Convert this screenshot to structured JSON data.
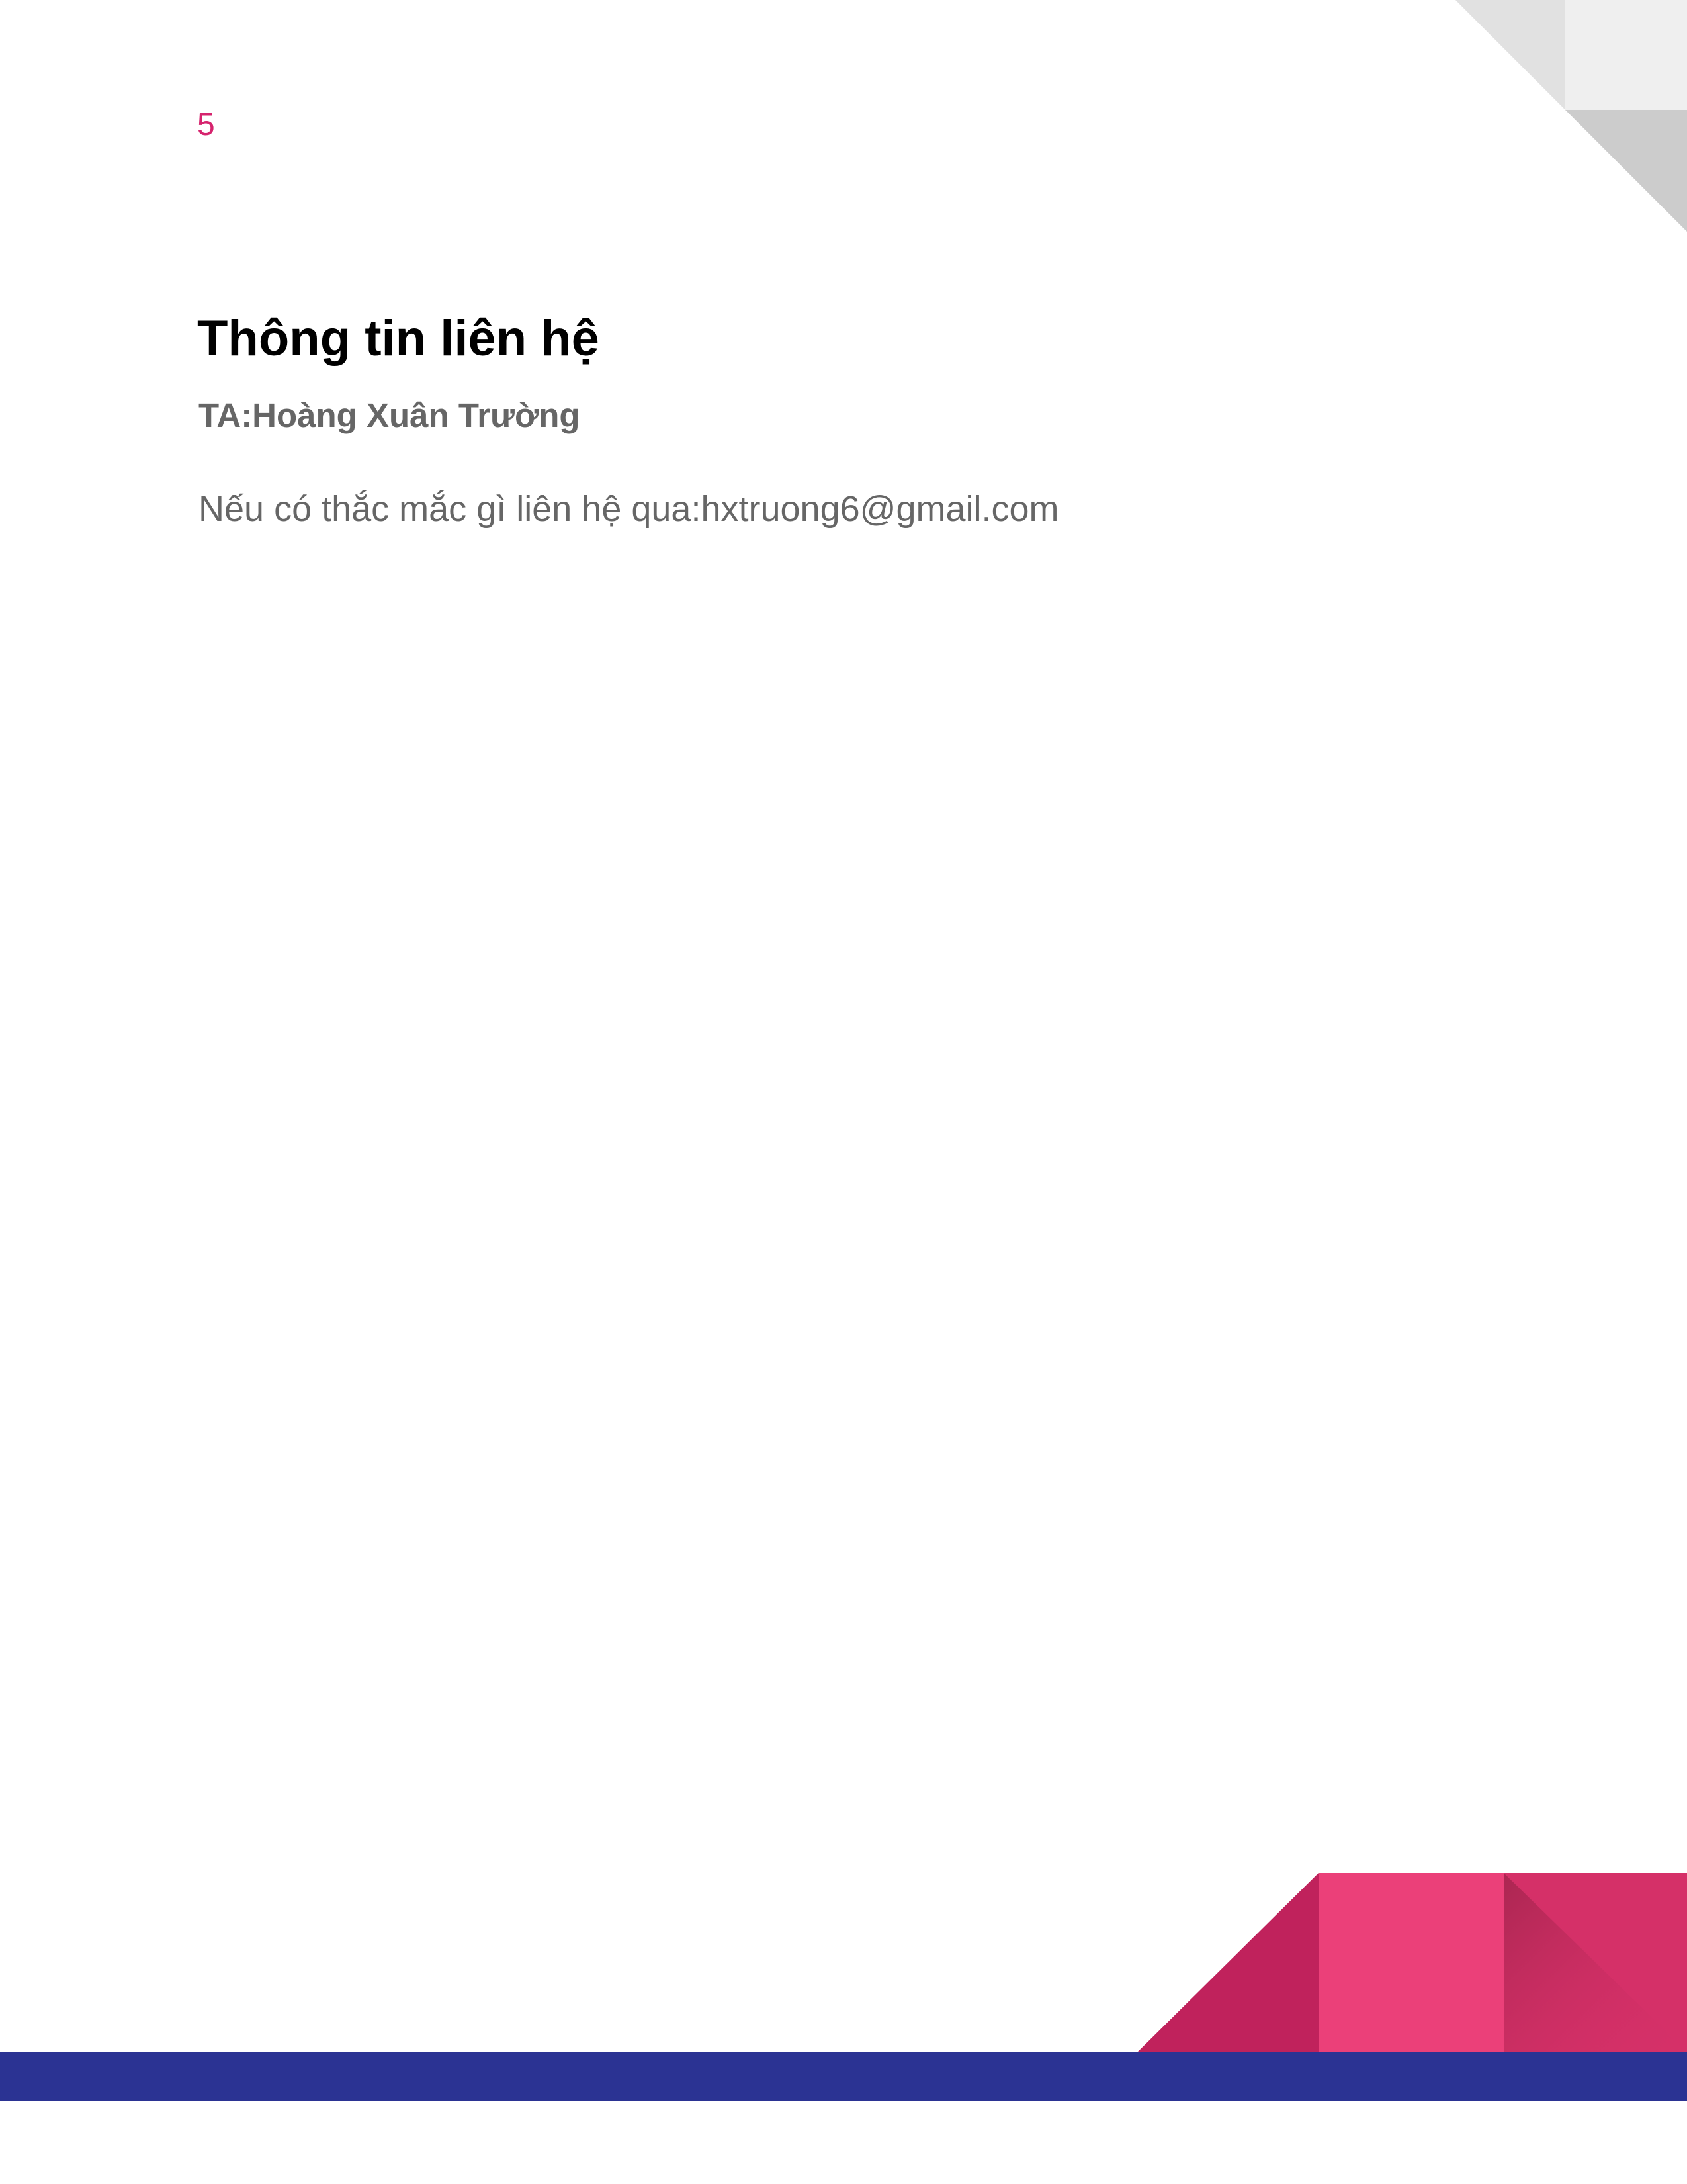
{
  "page": {
    "number": "5"
  },
  "contact": {
    "title": "Thông tin liên hệ",
    "ta_line": "TA:Hoàng Xuân Trường",
    "body": "Nếu có thắc mắc gì liên hệ qua:hxtruong6@gmail.com"
  },
  "colors": {
    "page_number": "#d6246e",
    "title": "#000000",
    "subtitle": "#666666",
    "body": "#666666",
    "corner_light": "#efefef",
    "corner_mid": "#e1e1e1",
    "corner_dark": "#cccccc",
    "pink_dark": "#c0225c",
    "pink_main": "#eb4079",
    "pink_right": "#d53068",
    "pink_shadow": "#a6254f",
    "navy_band": "#2b3393"
  }
}
